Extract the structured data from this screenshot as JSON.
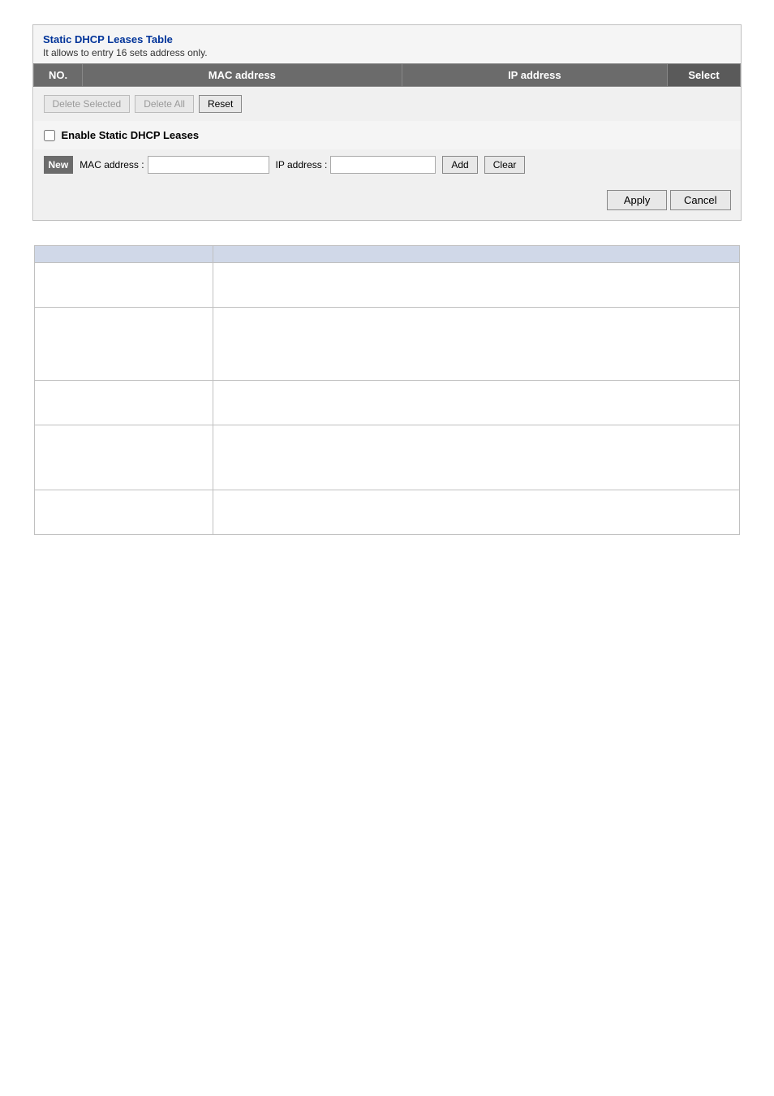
{
  "dhcp_section": {
    "title": "Static DHCP Leases Table",
    "subtitle": "It allows to entry 16 sets address only.",
    "table": {
      "headers": {
        "no": "NO.",
        "mac": "MAC address",
        "ip": "IP address",
        "select": "Select"
      },
      "buttons": {
        "delete_selected": "Delete Selected",
        "delete_all": "Delete All",
        "reset": "Reset"
      },
      "enable_label": "Enable Static DHCP Leases",
      "new_label": "New",
      "mac_address_label": "MAC address :",
      "ip_address_label": "IP address :",
      "add_button": "Add",
      "clear_button": "Clear",
      "apply_button": "Apply",
      "cancel_button": "Cancel"
    }
  },
  "info_table": {
    "headers": [
      "",
      ""
    ],
    "rows": [
      [
        "",
        ""
      ],
      [
        "",
        ""
      ],
      [
        "",
        ""
      ],
      [
        "",
        ""
      ],
      [
        "",
        ""
      ]
    ]
  }
}
